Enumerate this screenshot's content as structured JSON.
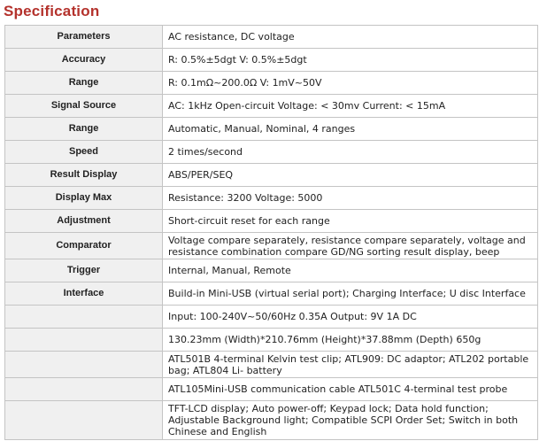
{
  "title": "Specification",
  "rows": [
    {
      "param": "Parameters",
      "value": "AC resistance, DC voltage"
    },
    {
      "param": "Accuracy",
      "value": "R: 0.5%±5dgt V: 0.5%±5dgt"
    },
    {
      "param": "Range",
      "value": "R: 0.1mΩ~200.0Ω V: 1mV~50V"
    },
    {
      "param": "Signal Source",
      "value": "AC: 1kHz Open-circuit Voltage: < 30mv Current: < 15mA"
    },
    {
      "param": "Range",
      "value": "Automatic, Manual, Nominal, 4 ranges"
    },
    {
      "param": "Speed",
      "value": "2 times/second"
    },
    {
      "param": "Result Display",
      "value": "ABS/PER/SEQ"
    },
    {
      "param": "Display Max",
      "value": "Resistance: 3200 Voltage: 5000"
    },
    {
      "param": "Adjustment",
      "value": "Short-circuit reset for each range"
    },
    {
      "param": "Comparator",
      "value": "Voltage compare separately, resistance compare separately, voltage and resistance combination compare GD/NG sorting result display, beep"
    },
    {
      "param": "Trigger",
      "value": "Internal, Manual, Remote"
    },
    {
      "param": "Interface",
      "value": "Build-in Mini-USB (virtual serial port); Charging Interface; U disc Interface"
    },
    {
      "param": "",
      "value": "Input: 100-240V~50/60Hz 0.35A Output: 9V 1A DC"
    },
    {
      "param": "",
      "value": "130.23mm (Width)*210.76mm (Height)*37.88mm (Depth) 650g"
    },
    {
      "param": "",
      "value": "ATL501B 4-terminal Kelvin test clip; ATL909: DC adaptor; ATL202 portable bag; ATL804 Li- battery"
    },
    {
      "param": "",
      "value": "ATL105Mini-USB communication cable ATL501C 4-terminal test probe"
    },
    {
      "param": "",
      "value": "TFT-LCD display; Auto power-off; Keypad lock; Data hold function; Adjustable Background light; Compatible SCPI Order Set; Switch in both Chinese and English"
    }
  ]
}
